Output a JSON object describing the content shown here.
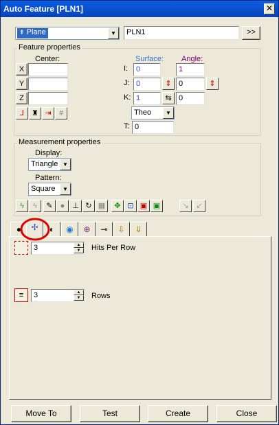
{
  "window": {
    "title": "Auto Feature [PLN1]",
    "close_glyph": "✕"
  },
  "top": {
    "feature_type": "Plane",
    "feature_icon": "plane-icon",
    "feature_name": "PLN1",
    "more_button": ">>"
  },
  "feature_properties": {
    "legend": "Feature properties",
    "center_label": "Center:",
    "axes": [
      "X",
      "Y",
      "Z"
    ],
    "center_values": [
      "",
      "",
      ""
    ],
    "surface_label": "Surface:",
    "angle_label": "Angle:",
    "ijk_labels": [
      "I:",
      "J:",
      "K:"
    ],
    "surface_values": [
      "0",
      "0",
      "1"
    ],
    "angle_values": [
      "1",
      "0",
      "0"
    ],
    "theo_option": "Theo",
    "t_label": "T:",
    "t_value": "0"
  },
  "measurement_properties": {
    "legend": "Measurement properties",
    "display_label": "Display:",
    "display_value": "Triangle",
    "pattern_label": "Pattern:",
    "pattern_value": "Square"
  },
  "tabs": {
    "active_index": 1,
    "items": [
      "ball-icon",
      "hits-icon",
      "contact-icon",
      "eye-icon",
      "target-icon",
      "probe-icon",
      "clearance-icon",
      "clearance-check-icon"
    ]
  },
  "hits": {
    "hits_per_row_value": "3",
    "hits_per_row_label": "Hits Per Row",
    "rows_value": "3",
    "rows_label": "Rows"
  },
  "buttons": {
    "move_to": "Move To",
    "test": "Test",
    "create": "Create",
    "close": "Close"
  },
  "colors": {
    "titlebar": "#0842b8",
    "selection": "#316ac5",
    "surface_label": "#2f74d0",
    "angle_label": "#800080",
    "annotation_circle": "#e00000"
  }
}
